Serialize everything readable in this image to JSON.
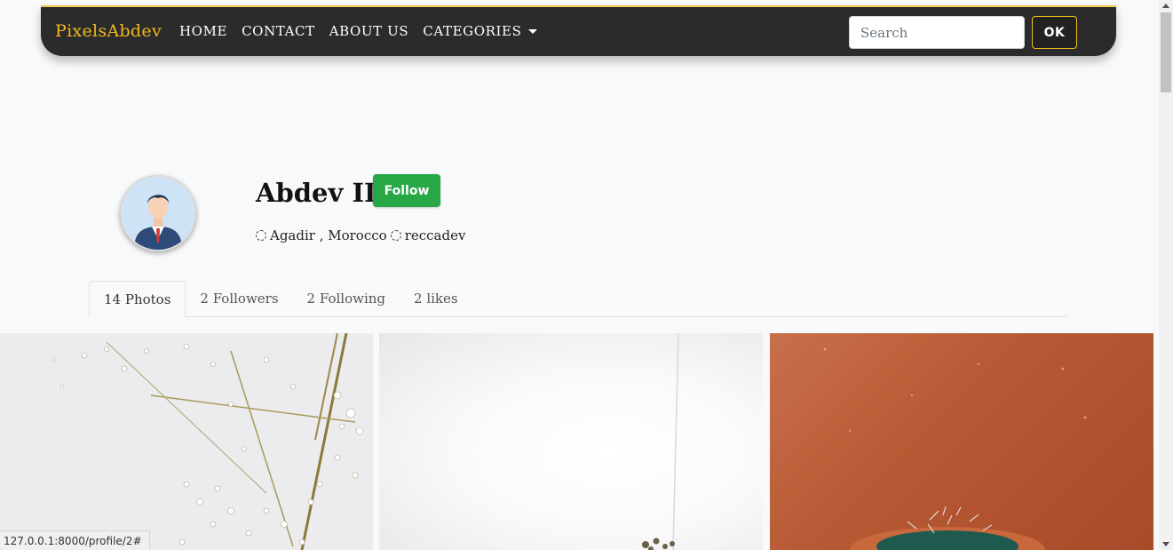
{
  "navbar": {
    "brand": "PixelsAbdev",
    "links": [
      "HOME",
      "CONTACT",
      "ABOUT US",
      "CATEGORIES"
    ],
    "search_placeholder": "Search",
    "ok_label": "OK",
    "accent_color": "#f0b91c"
  },
  "profile": {
    "name": "Abdev ID",
    "follow_label": "Follow",
    "location": "Agadir , Morocco",
    "username": "reccadev",
    "follow_color": "#28a745"
  },
  "tabs": [
    "14 Photos",
    "2 Followers",
    "2 Following",
    "2 likes"
  ],
  "status_url": "127.0.0.1:8000/profile/2#"
}
